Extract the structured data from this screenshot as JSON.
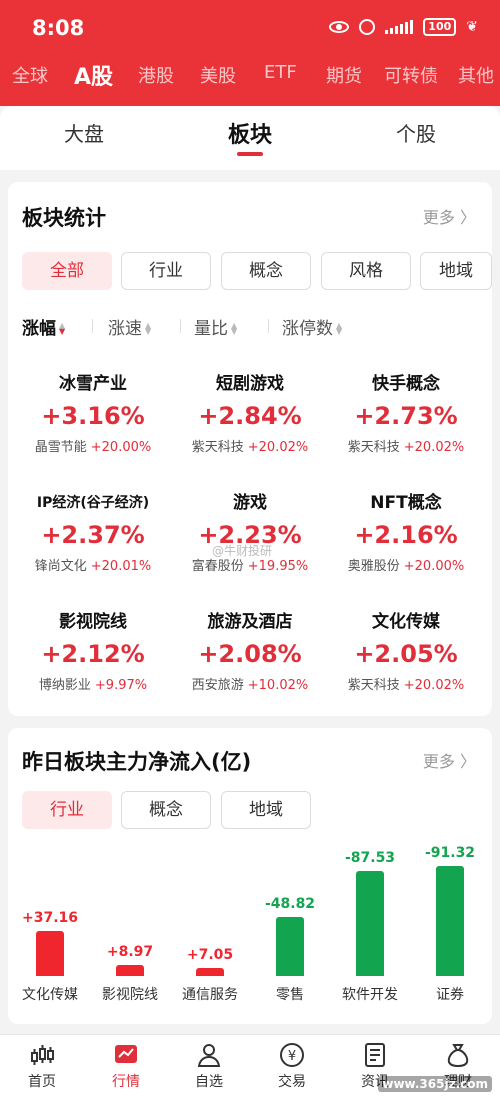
{
  "status_bar": {
    "time": "8:08",
    "battery": "100"
  },
  "market_tabs": [
    "全球",
    "A股",
    "港股",
    "美股",
    "ETF",
    "期货",
    "可转债",
    "其他"
  ],
  "sub_tabs": [
    "大盘",
    "板块",
    "个股"
  ],
  "sector_stats": {
    "title": "板块统计",
    "more": "更多 〉",
    "filters": [
      "全部",
      "行业",
      "概念",
      "风格",
      "地域"
    ],
    "sorts": [
      "涨幅",
      "涨速",
      "量比",
      "涨停数"
    ],
    "sectors": [
      {
        "name": "冰雪产业",
        "pct": "+3.16%",
        "leader": "晶雪节能",
        "leader_pct": "+20.00%"
      },
      {
        "name": "短剧游戏",
        "pct": "+2.84%",
        "leader": "紫天科技",
        "leader_pct": "+20.02%"
      },
      {
        "name": "快手概念",
        "pct": "+2.73%",
        "leader": "紫天科技",
        "leader_pct": "+20.02%"
      },
      {
        "name": "IP经济(谷子经济)",
        "pct": "+2.37%",
        "leader": "锋尚文化",
        "leader_pct": "+20.01%"
      },
      {
        "name": "游戏",
        "pct": "+2.23%",
        "leader": "富春股份",
        "leader_pct": "+19.95%"
      },
      {
        "name": "NFT概念",
        "pct": "+2.16%",
        "leader": "奥雅股份",
        "leader_pct": "+20.00%"
      },
      {
        "name": "影视院线",
        "pct": "+2.12%",
        "leader": "博纳影业",
        "leader_pct": "+9.97%"
      },
      {
        "name": "旅游及酒店",
        "pct": "+2.08%",
        "leader": "西安旅游",
        "leader_pct": "+10.02%"
      },
      {
        "name": "文化传媒",
        "pct": "+2.05%",
        "leader": "紫天科技",
        "leader_pct": "+20.02%"
      }
    ]
  },
  "capital_flow": {
    "title": "昨日板块主力净流入(亿)",
    "more": "更多 〉",
    "filters": [
      "行业",
      "概念",
      "地域"
    ]
  },
  "chart_data": {
    "type": "bar",
    "categories": [
      "文化传媒",
      "影视院线",
      "通信服务",
      "零售",
      "软件开发",
      "证券"
    ],
    "values": [
      37.16,
      8.97,
      7.05,
      -48.82,
      -87.53,
      -91.32
    ],
    "value_labels": [
      "+37.16",
      "+8.97",
      "+7.05",
      "-48.82",
      "-87.53",
      "-91.32"
    ],
    "title": "昨日板块主力净流入(亿)",
    "positive_color": "#f0262f",
    "negative_color": "#12a44e"
  },
  "bottom_nav": [
    "首页",
    "行情",
    "自选",
    "交易",
    "资讯",
    "理财"
  ],
  "watermark": "www.365jz.com",
  "weibo_mark": "@牛财投研",
  "colors": {
    "brand_red": "#e93338",
    "rise": "#e02e3a",
    "fall": "#12a44e"
  }
}
